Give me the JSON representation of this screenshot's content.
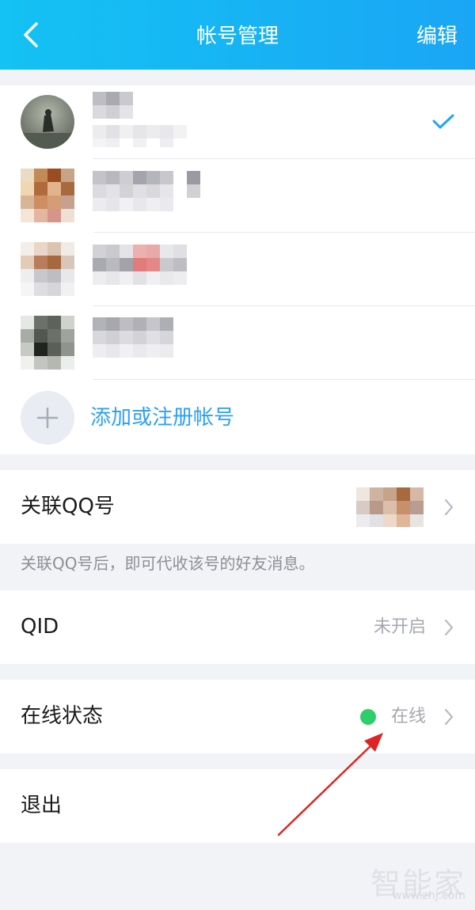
{
  "header": {
    "title": "帐号管理",
    "edit_label": "编辑",
    "back_icon": "chevron-left-icon"
  },
  "accounts": {
    "add_label": "添加或注册帐号",
    "add_icon": "plus-icon",
    "selected_icon": "checkmark-icon"
  },
  "linked_qq": {
    "label": "关联QQ号",
    "note": "关联QQ号后，即可代收该号的好友消息。"
  },
  "qid": {
    "label": "QID",
    "value": "未开启"
  },
  "online_status": {
    "label": "在线状态",
    "value": "在线",
    "indicator_color": "#2ecf6a"
  },
  "logout": {
    "label": "退出"
  },
  "watermark": {
    "brand": "智能家",
    "url": "www.znj.com"
  },
  "colors": {
    "header_start": "#14c2f3",
    "header_end": "#1aa6f5",
    "accent_blue": "#2d9ff5",
    "annotation_arrow": "#e02424"
  }
}
